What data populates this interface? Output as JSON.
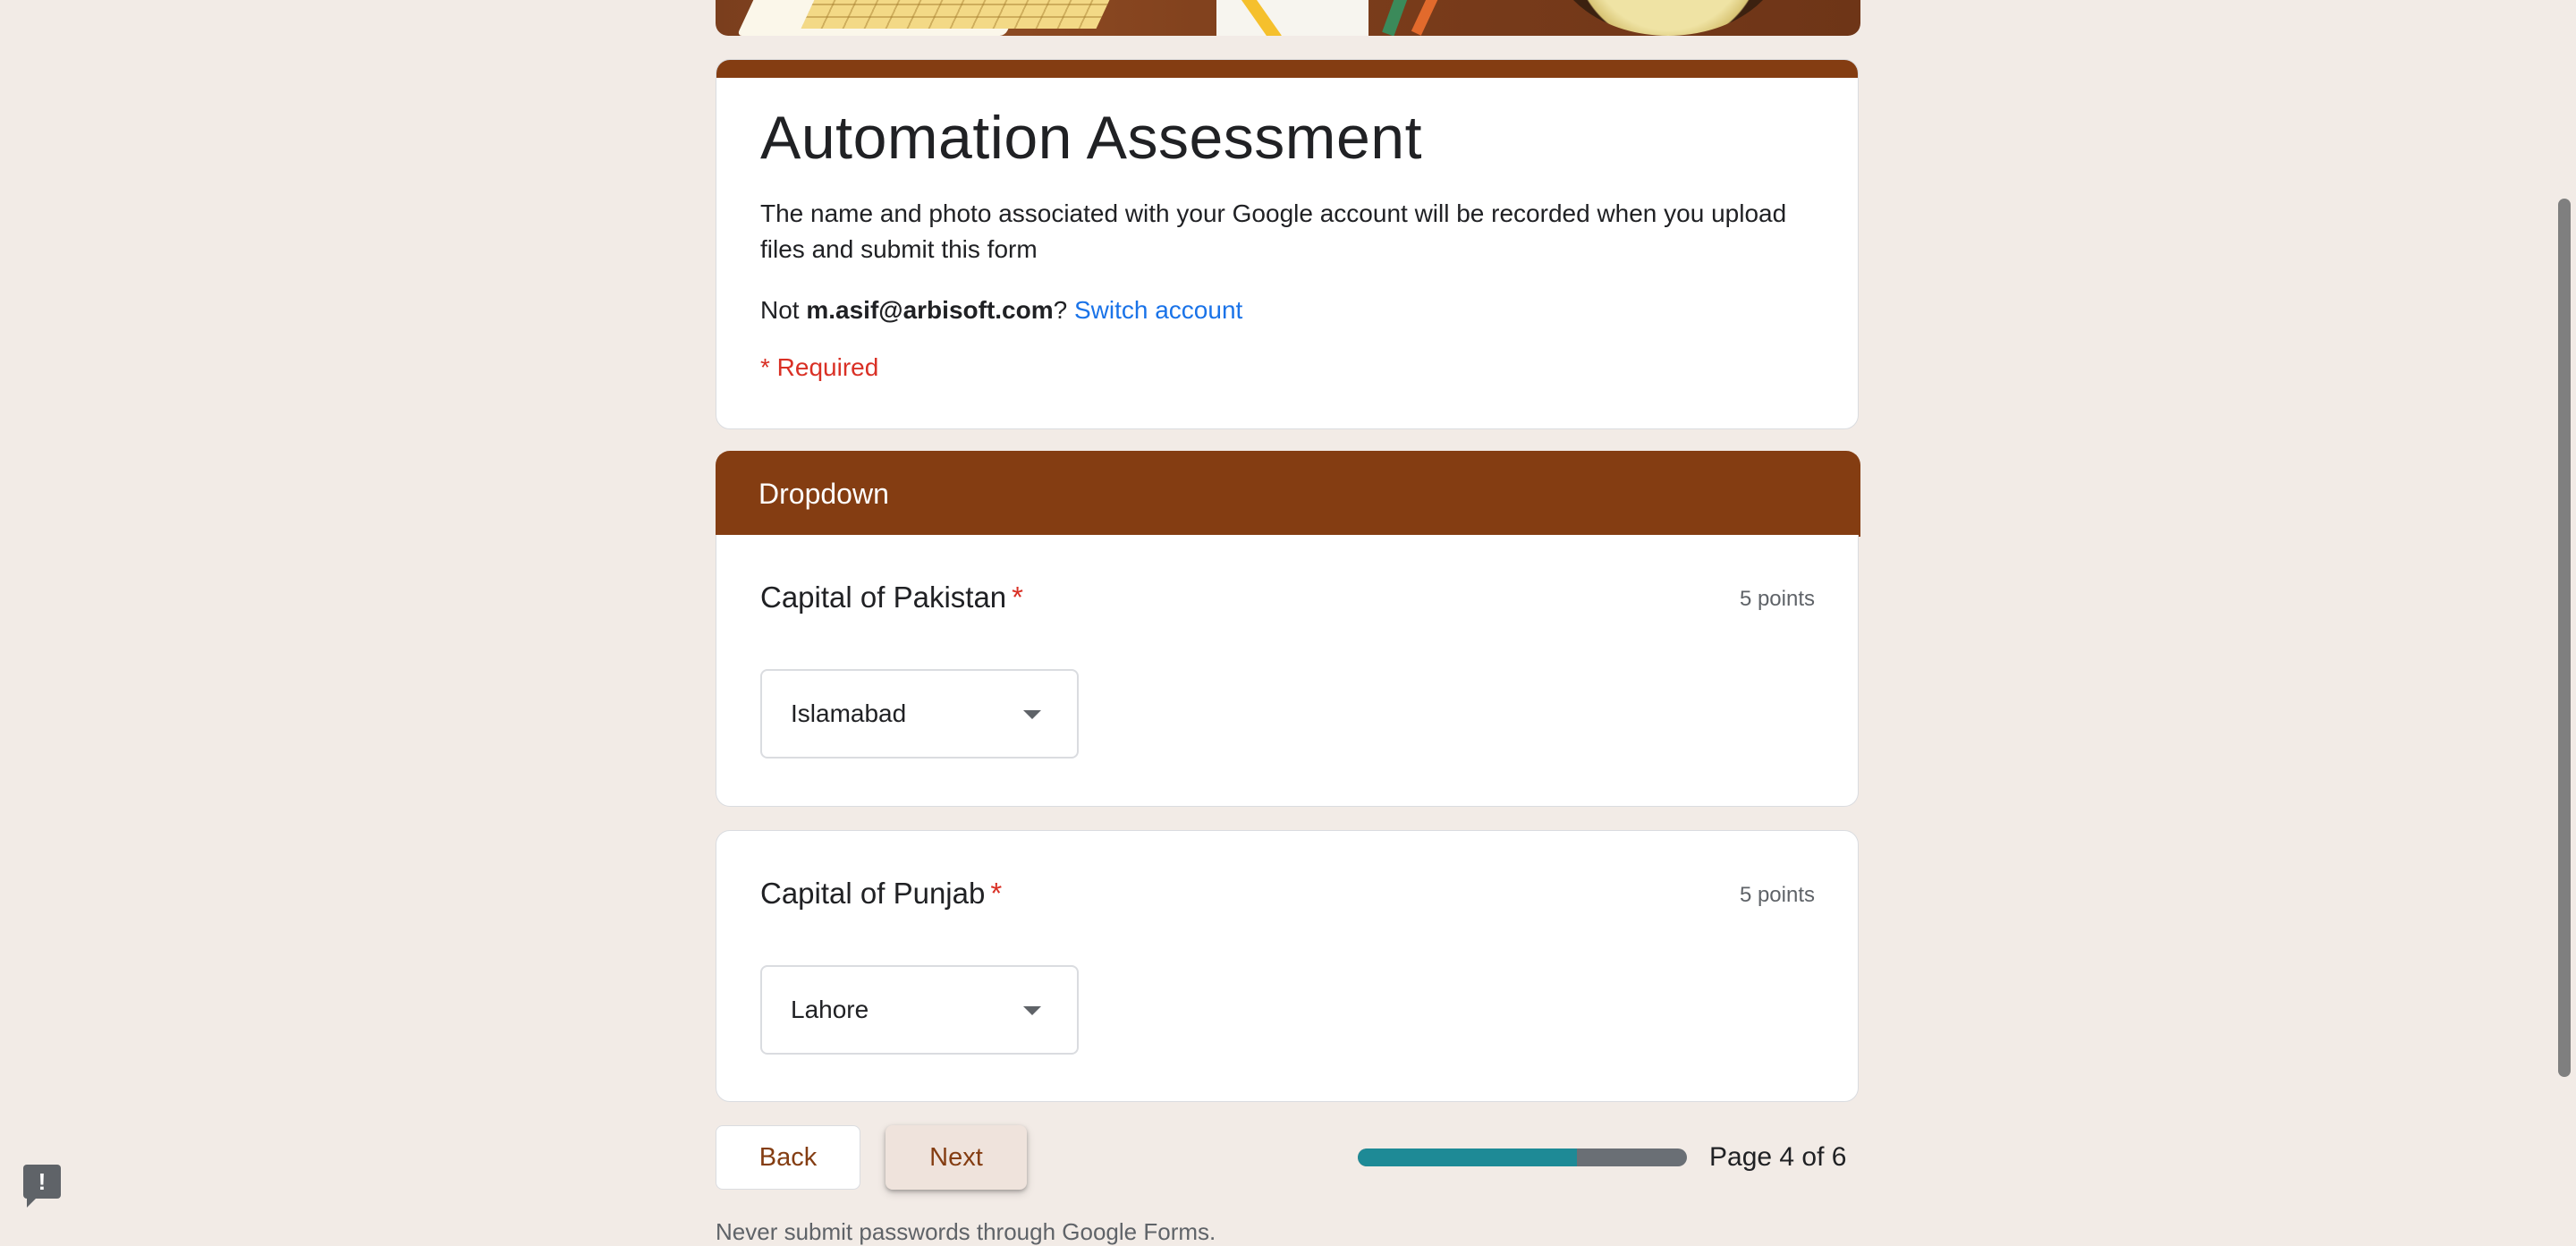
{
  "form": {
    "title": "Automation Assessment",
    "description": "The name and photo associated with your Google account will be recorded when you upload files and submit this form",
    "account_prefix": "Not",
    "account_email": "m.asif@arbisoft.com",
    "account_suffix": "?",
    "switch_account": "Switch account",
    "required_note": "* Required"
  },
  "section": {
    "title": "Dropdown"
  },
  "questions": [
    {
      "title": "Capital of Pakistan",
      "required_mark": "*",
      "points": "5 points",
      "selected": "Islamabad"
    },
    {
      "title": "Capital of Punjab",
      "required_mark": "*",
      "points": "5 points",
      "selected": "Lahore"
    }
  ],
  "nav": {
    "back": "Back",
    "next": "Next",
    "page_label": "Page 4 of 6",
    "progress_fraction": 0.667
  },
  "footer": {
    "note": "Never submit passwords through Google Forms."
  },
  "colors": {
    "theme": "#843d12",
    "background": "#f2ebe6",
    "progress_fill": "#1e8a96",
    "link": "#1a73e8",
    "required": "#d93025"
  },
  "icons": {
    "feedback": "report-feedback-icon",
    "dropdown": "arrow-drop-down-icon"
  }
}
